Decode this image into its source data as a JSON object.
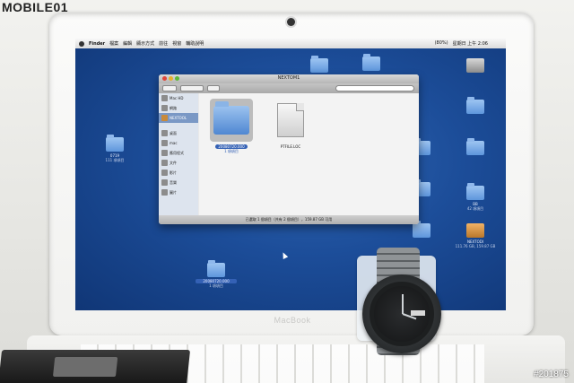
{
  "watermark": {
    "logo": "MOBILE01",
    "id": "#201875"
  },
  "device_label": "MacBook",
  "menubar": {
    "app": "Finder",
    "items": [
      "檔案",
      "編輯",
      "顯示方式",
      "前往",
      "視窗",
      "輔助說明"
    ],
    "status": "(80%)",
    "clock": "星期日 上午 2:06"
  },
  "finder": {
    "title": "NEXTOM1",
    "sidebar": [
      {
        "label": "Mac HD",
        "icon": "hard-drive-icon"
      },
      {
        "label": "網路",
        "icon": "network-icon"
      },
      {
        "label": "NEXTOOL",
        "icon": "external-drive-icon",
        "selected": true
      },
      {
        "label": "桌面",
        "icon": "desktop-icon"
      },
      {
        "label": "mac",
        "icon": "home-icon"
      },
      {
        "label": "應用程式",
        "icon": "applications-icon"
      },
      {
        "label": "文件",
        "icon": "documents-icon"
      },
      {
        "label": "影片",
        "icon": "movies-icon"
      },
      {
        "label": "音樂",
        "icon": "music-icon"
      },
      {
        "label": "圖片",
        "icon": "pictures-icon"
      }
    ],
    "items": [
      {
        "name": "20080720.000",
        "sub": "1 項項目",
        "kind": "folder",
        "selected": true
      },
      {
        "name": "PTFILE.LOC",
        "sub": "",
        "kind": "document",
        "selected": false
      }
    ],
    "status": "已選取 1 個項目（共有 2 個項目），159.87 GB 可用"
  },
  "desktop_icons": [
    {
      "label": "0719",
      "sub": "111 項項目"
    },
    {
      "label": "20080720.000",
      "sub": "1 項項目"
    },
    {
      "label": "NEXTODI",
      "sub": "111.76 GB, 159.87 GB"
    },
    {
      "label": "BB",
      "sub": "42 項項目"
    }
  ]
}
